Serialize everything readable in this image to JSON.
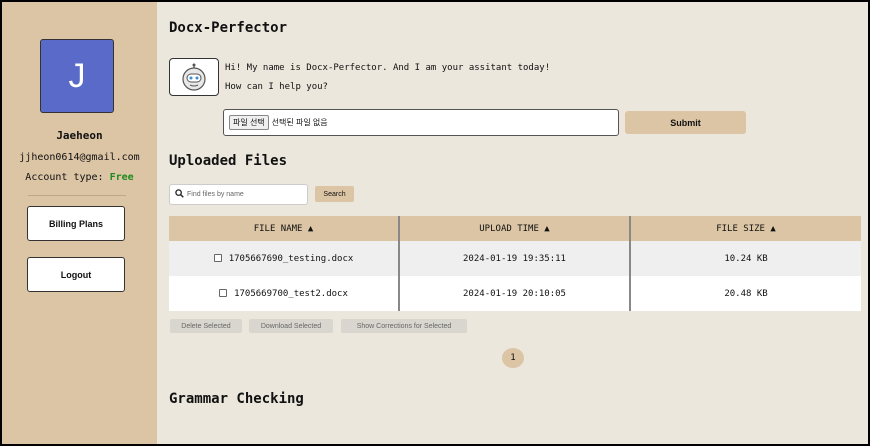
{
  "user": {
    "initial": "J",
    "name": "Jaeheon",
    "email": "jjheon0614@gmail.com",
    "account_label": "Account type:",
    "account_type": "Free"
  },
  "sidebar": {
    "billing_label": "Billing Plans",
    "logout_label": "Logout"
  },
  "app": {
    "title": "Docx-Perfector"
  },
  "assistant": {
    "icon": "robot-icon",
    "line1": "Hi! My name is Docx-Perfector. And I am your assitant today!",
    "line2": "How can I help you?"
  },
  "upload": {
    "choose_label": "파일 선택",
    "no_file_text": "선택된 파일 없음",
    "submit_label": "Submit"
  },
  "files": {
    "heading": "Uploaded Files",
    "search_placeholder": "Find files by name",
    "search_label": "Search",
    "columns": [
      "FILE NAME ▲",
      "UPLOAD TIME ▲",
      "FILE SIZE ▲"
    ],
    "rows": [
      {
        "name": "1705667690_testing.docx",
        "time": "2024-01-19 19:35:11",
        "size": "10.24 KB"
      },
      {
        "name": "1705669700_test2.docx",
        "time": "2024-01-19 20:10:05",
        "size": "20.48 KB"
      }
    ],
    "actions": {
      "delete": "Delete Selected",
      "download": "Download Selected",
      "corrections": "Show Corrections for Selected"
    },
    "page": "1"
  },
  "grammar": {
    "heading": "Grammar Checking"
  },
  "colors": {
    "sidebar_bg": "#dcc5a5",
    "page_bg": "#ebe7dc",
    "avatar_bg": "#5a6ac8",
    "free_green": "#1e8a1e"
  }
}
